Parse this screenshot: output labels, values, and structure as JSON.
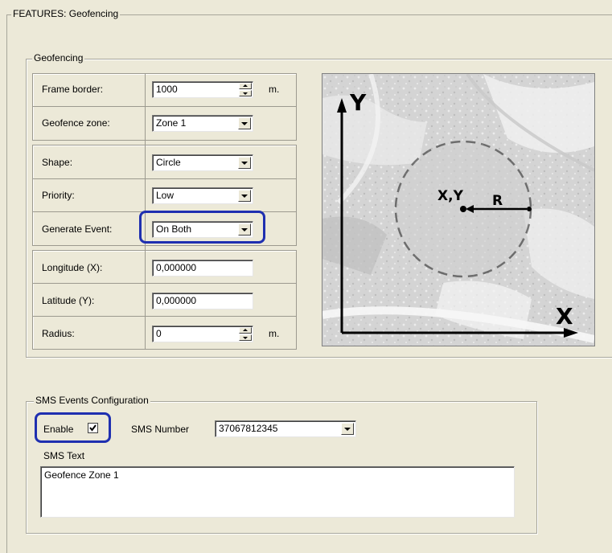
{
  "features_title": "FEATURES: Geofencing",
  "geofencing": {
    "title": "Geofencing",
    "frame_border": {
      "label": "Frame border:",
      "value": "1000",
      "unit": "m."
    },
    "geofence_zone": {
      "label": "Geofence zone:",
      "value": "Zone 1"
    },
    "shape": {
      "label": "Shape:",
      "value": "Circle"
    },
    "priority": {
      "label": "Priority:",
      "value": "Low"
    },
    "generate_event": {
      "label": "Generate Event:",
      "value": "On Both"
    },
    "longitude": {
      "label": "Longitude (X):",
      "value": "0,000000"
    },
    "latitude": {
      "label": "Latitude (Y):",
      "value": "0,000000"
    },
    "radius": {
      "label": "Radius:",
      "value": "0",
      "unit": "m."
    }
  },
  "diagram": {
    "axis_y": "Y",
    "axis_x": "X",
    "center_label": "X,Y",
    "radius_label": "R"
  },
  "sms": {
    "title": "SMS Events Configuration",
    "enable_label": "Enable",
    "enable_checked": true,
    "number_label": "SMS Number",
    "number_value": "37067812345",
    "text_label": "SMS Text",
    "text_value": "Geofence Zone 1"
  },
  "colors": {
    "panel": "#ece9d8",
    "highlight": "#1f2fb0"
  }
}
